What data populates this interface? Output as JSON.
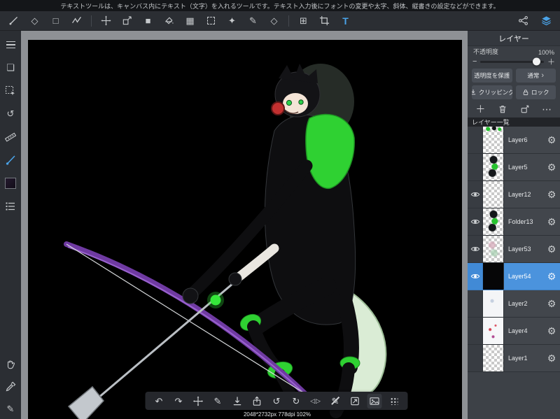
{
  "info_bar": {
    "text": "テキストツールは、キャンバス内にテキスト（文字）を入れるツールです。テキスト入力後にフォントの変更や太字、斜体、縦書きの設定などができます。"
  },
  "icons": {
    "eraser": "◇",
    "marquee": "□",
    "fill_rect": "■",
    "gradient": "▦",
    "grid": "⊞",
    "wand": "✦",
    "text_tool": "T",
    "pages": "❏",
    "rotate_view": "↺",
    "pencil": "✎",
    "undo": "↶",
    "redo": "↷",
    "rotate_ccw": "↺",
    "rotate_cw": "↻",
    "flip_left": "◁",
    "flip_right": "▷",
    "gear": "⚙",
    "plus": "＋",
    "dots": "⋯",
    "chevron_right": "›",
    "slider_minus": "−",
    "slider_plus": "＋"
  },
  "layers_panel": {
    "title": "レイヤー",
    "opacity_label": "不透明度",
    "opacity_value": "100%",
    "protect_alpha_label": "透明度を保護",
    "blend_mode_value": "通常",
    "clipping_label": "クリッピング",
    "lock_label": "ロック",
    "list_title": "レイヤー一覧",
    "layers": [
      {
        "name": "Layer6",
        "visible": false,
        "selected": false,
        "thumb": "sprites"
      },
      {
        "name": "Layer5",
        "visible": false,
        "selected": false,
        "thumb": "char"
      },
      {
        "name": "Layer12",
        "visible": true,
        "selected": false,
        "thumb": "empty"
      },
      {
        "name": "Folder13",
        "visible": true,
        "selected": false,
        "thumb": "char"
      },
      {
        "name": "Layer53",
        "visible": true,
        "selected": false,
        "thumb": "faint"
      },
      {
        "name": "Layer54",
        "visible": true,
        "selected": true,
        "thumb": "black"
      },
      {
        "name": "Layer2",
        "visible": false,
        "selected": false,
        "thumb": "white"
      },
      {
        "name": "Layer4",
        "visible": false,
        "selected": false,
        "thumb": "white_red"
      },
      {
        "name": "Layer1",
        "visible": false,
        "selected": false,
        "thumb": "empty"
      }
    ]
  },
  "status_bar": {
    "text": "2048*2732px 778dpi 102%"
  },
  "colors": {
    "accent_blue": "#4b93dd",
    "bright_green": "#2fd132",
    "bow_purple": "#7b3fae",
    "headphone_red": "#c23030"
  }
}
